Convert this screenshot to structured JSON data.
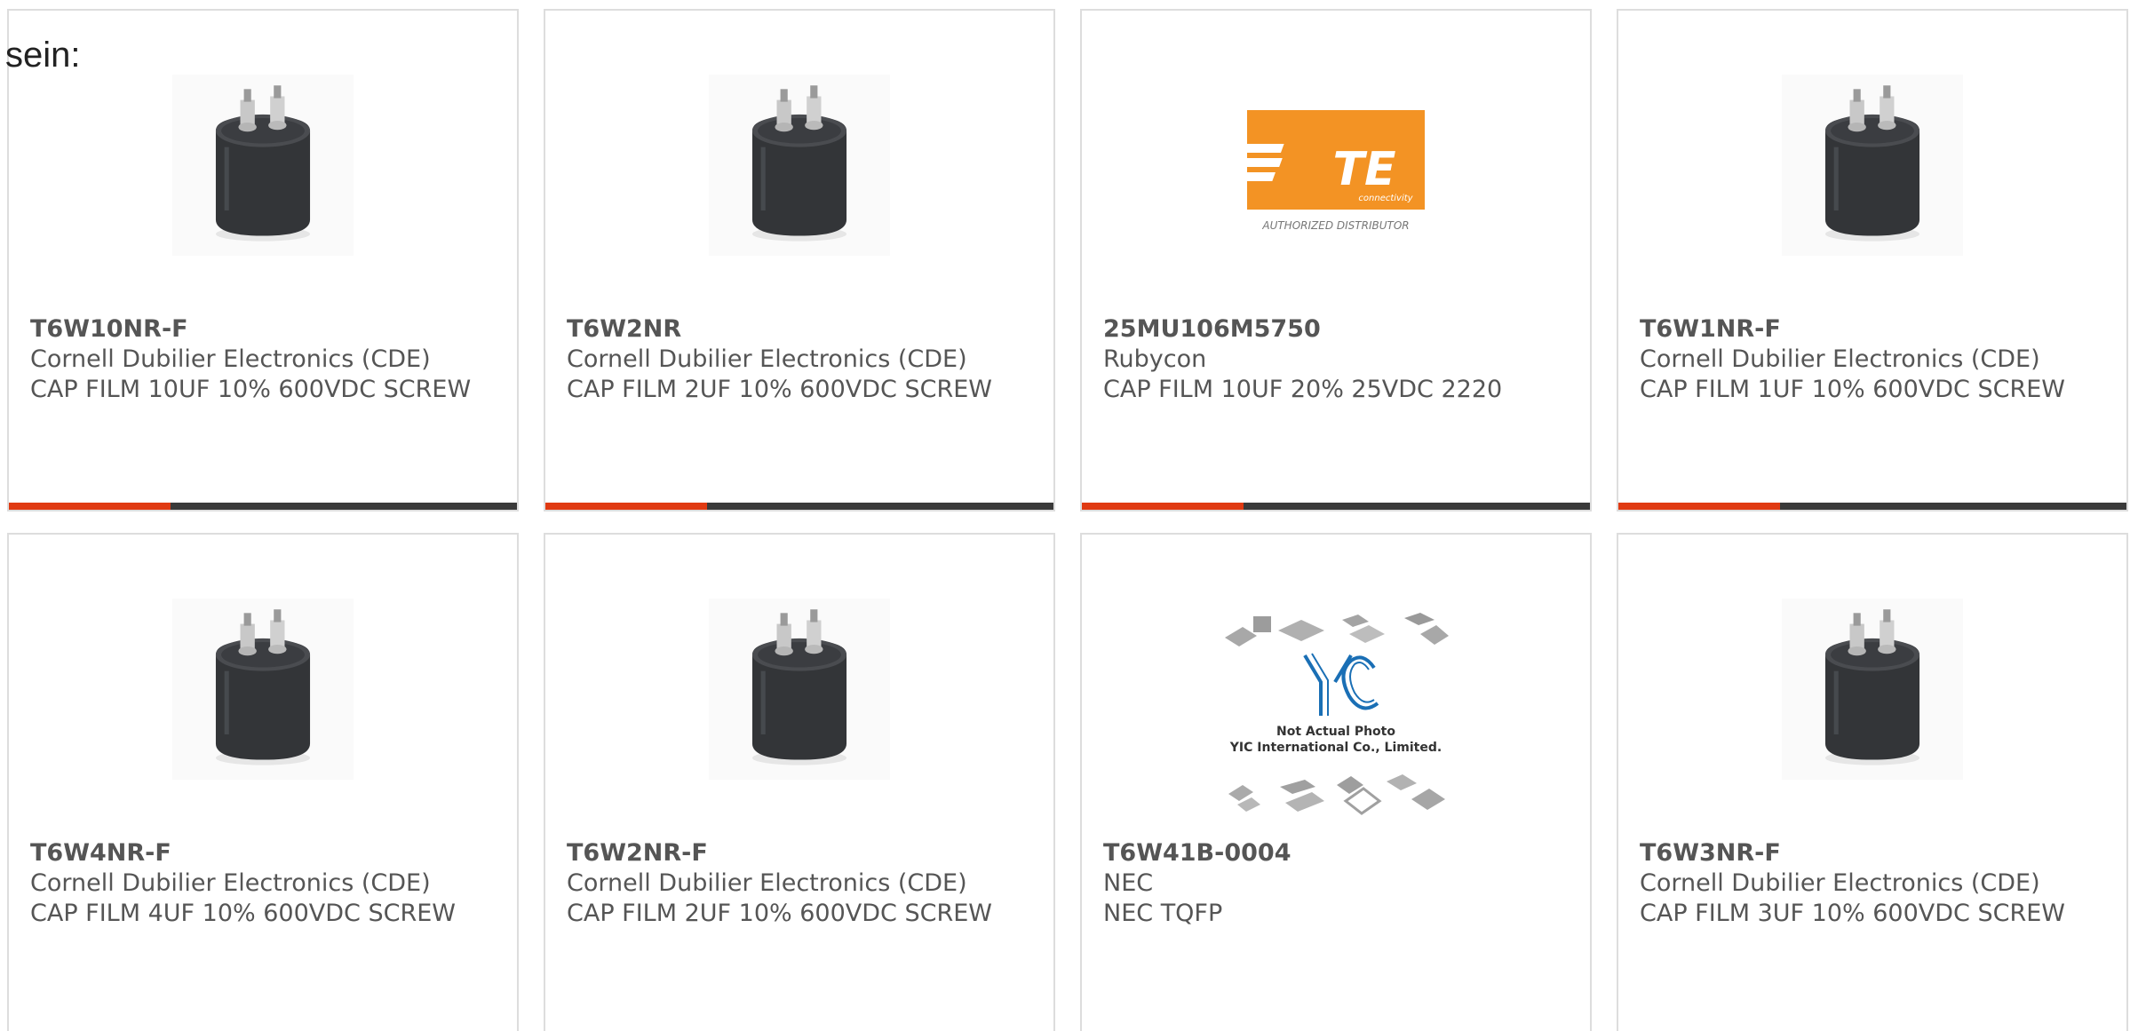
{
  "intro_text": "sein:",
  "colors": {
    "bar_dark": "#3a3a3a",
    "bar_accent": "#e03a12",
    "border": "#dddddd",
    "text": "#555555",
    "te_orange": "#f39324",
    "yic_blue": "#1a6fb5"
  },
  "products": [
    {
      "part": "T6W10NR-F",
      "brand": "Cornell Dubilier Electronics (CDE)",
      "desc": "CAP FILM 10UF 10% 600VDC SCREW",
      "image": "capacitor-image"
    },
    {
      "part": "T6W2NR",
      "brand": "Cornell Dubilier Electronics (CDE)",
      "desc": "CAP FILM 2UF 10% 600VDC SCREW",
      "image": "capacitor-image"
    },
    {
      "part": "25MU106M5750",
      "brand": "Rubycon",
      "desc": "CAP FILM 10UF 20% 25VDC 2220",
      "image": "te-logo-image",
      "logo_text": "TE",
      "logo_subtext": "connectivity",
      "logo_caption": "AUTHORIZED DISTRIBUTOR"
    },
    {
      "part": "T6W1NR-F",
      "brand": "Cornell Dubilier Electronics (CDE)",
      "desc": "CAP FILM 1UF 10% 600VDC SCREW",
      "image": "capacitor-image"
    },
    {
      "part": "T6W4NR-F",
      "brand": "Cornell Dubilier Electronics (CDE)",
      "desc": "CAP FILM 4UF 10% 600VDC SCREW",
      "image": "capacitor-image"
    },
    {
      "part": "T6W2NR-F",
      "brand": "Cornell Dubilier Electronics (CDE)",
      "desc": "CAP FILM 2UF 10% 600VDC SCREW",
      "image": "capacitor-image"
    },
    {
      "part": "T6W41B-0004",
      "brand": "NEC",
      "desc": "NEC TQFP",
      "image": "yic-placeholder-image",
      "logo_text": "YIC",
      "photo_line1": "Not Actual Photo",
      "photo_line2": "YIC International Co., Limited."
    },
    {
      "part": "T6W3NR-F",
      "brand": "Cornell Dubilier Electronics (CDE)",
      "desc": "CAP FILM 3UF 10% 600VDC SCREW",
      "image": "capacitor-image"
    }
  ]
}
